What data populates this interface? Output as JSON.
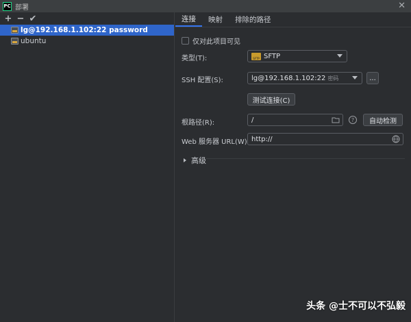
{
  "window": {
    "title": "部署",
    "logo_text": "PC"
  },
  "toolbar": {
    "add": "+",
    "remove": "−",
    "apply": "✔"
  },
  "servers": [
    {
      "label": "lg@192.168.1.102:22 password",
      "selected": true
    },
    {
      "label": "ubuntu",
      "selected": false
    }
  ],
  "tabs": [
    {
      "label": "连接",
      "active": true
    },
    {
      "label": "映射",
      "active": false
    },
    {
      "label": "排除的路径",
      "active": false
    }
  ],
  "form": {
    "visible_only_label": "仅对此项目可见",
    "type_label": "类型(T):",
    "type_value": "SFTP",
    "ssh_label": "SSH 配置(S):",
    "ssh_value": "lg@192.168.1.102:22",
    "ssh_hint": "密码",
    "ellipsis": "...",
    "test_button": "测试连接(C)",
    "root_label": "根路径(R):",
    "root_value": "/",
    "autodetect_button": "自动检测",
    "web_url_label": "Web 服务器 URL(W):",
    "web_url_value": "http://",
    "advanced_label": "高级"
  },
  "watermark": "头条 @士不可以不弘毅",
  "colors": {
    "accent": "#3574f0",
    "selection": "#2f65ca",
    "background": "#2b2d30"
  }
}
